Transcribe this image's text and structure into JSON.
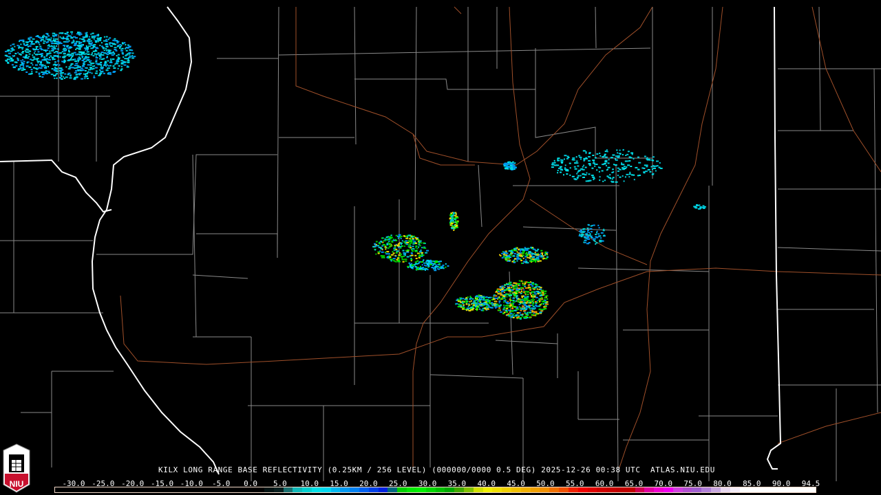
{
  "product": {
    "caption": "KILX LONG RANGE BASE REFLECTIVITY (0.25KM / 256 LEVEL) (000000/0000 0.5 DEG) 2025-12-26 00:38 UTC  ATLAS.NIU.EDU",
    "radar_site": "KILX",
    "elevation": "0.5 DEG",
    "timestamp": "2025-12-26 00:38 UTC",
    "source": "ATLAS.NIU.EDU"
  },
  "logo": {
    "text": "NIU"
  },
  "colorscale": {
    "labels": [
      "-30.0",
      "-25.0",
      "-20.0",
      "-15.0",
      "-10.0",
      "-5.0",
      "0.0",
      "5.0",
      "10.0",
      "15.0",
      "20.0",
      "25.0",
      "30.0",
      "35.0",
      "40.0",
      "45.0",
      "50.0",
      "55.0",
      "60.0",
      "65.0",
      "70.0",
      "75.0",
      "80.0",
      "85.0",
      "90.0",
      "94.5"
    ],
    "min": -30,
    "max": 94.5,
    "colors": [
      "#000000",
      "#000000",
      "#000000",
      "#000000",
      "#000000",
      "#000000",
      "#000000",
      "#000000",
      "#000000",
      "#000000",
      "#000000",
      "#000000",
      "#000000",
      "#000000",
      "#000000",
      "#000000",
      "#000000",
      "#000000",
      "#000000",
      "#000000",
      "#000000",
      "#000000",
      "#041414",
      "#0a2020",
      "#1a7070",
      "#10b8b8",
      "#00d0d0",
      "#00e0e8",
      "#00d8f0",
      "#00b8f0",
      "#0098f0",
      "#0080f0",
      "#0060f0",
      "#0040e8",
      "#0020e0",
      "#006880",
      "#00d000",
      "#00e800",
      "#00f000",
      "#00d800",
      "#00c000",
      "#00a800",
      "#40a800",
      "#80c000",
      "#d0e000",
      "#f0f000",
      "#f0e000",
      "#f0d000",
      "#f0c000",
      "#f0b000",
      "#f0a000",
      "#f09000",
      "#f07000",
      "#f05000",
      "#f02000",
      "#f00000",
      "#e00000",
      "#d00000",
      "#c80000",
      "#c00000",
      "#c00000",
      "#d00050",
      "#e000a0",
      "#f000d0",
      "#f000f0",
      "#d040e0",
      "#b050d0",
      "#a060d0",
      "#b080d8",
      "#c8a8e0",
      "#e8d8f0",
      "#f4ecf8",
      "#ffffff",
      "#ffffff",
      "#ffffff",
      "#ffffff",
      "#ffffff",
      "#ffffff",
      "#ffffff",
      "#ffffff"
    ]
  }
}
